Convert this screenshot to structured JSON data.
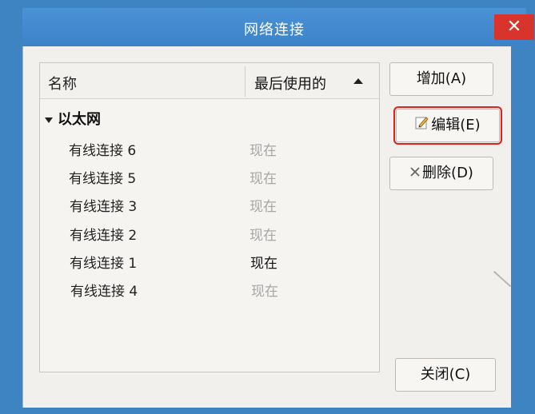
{
  "window": {
    "title": "网络连接",
    "close_symbol": "✕"
  },
  "list": {
    "columns": {
      "name": "名称",
      "last_used": "最后使用的"
    },
    "group": "以太网",
    "rows": [
      {
        "name": "有线连接 6",
        "last_used": "现在"
      },
      {
        "name": "有线连接 5",
        "last_used": "现在"
      },
      {
        "name": "有线连接 3",
        "last_used": "现在"
      },
      {
        "name": "有线连接 2",
        "last_used": "现在"
      },
      {
        "name": "有线连接 1",
        "last_used": "现在"
      },
      {
        "name": "有线连接 4",
        "last_used": "现在"
      }
    ]
  },
  "buttons": {
    "add": "增加(A)",
    "edit": "编辑(E)",
    "delete": "删除(D)",
    "close": "关闭(C)"
  },
  "icons": {
    "edit": "pencil-icon",
    "delete": "x-icon"
  },
  "colors": {
    "titlebar": "#4a91d6",
    "close_button": "#d9342b",
    "highlight_outline": "#e0201b",
    "inactive_time": "#a6a6a6"
  }
}
